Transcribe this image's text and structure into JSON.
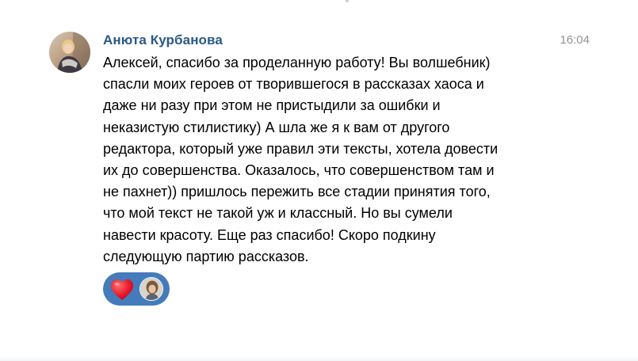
{
  "message": {
    "author": "Анюта Курбанова",
    "time": "16:04",
    "text": "Алексей, спасибо за проделанную работу! Вы волшебник)\nспасли моих героев от творившегося в рассказах хаоса и\nдаже ни разу  при этом не пристыдили за ошибки и\nнеказистую стилистику) А шла же я к вам от другого\nредактора, который уже правил эти тексты, хотела довести\nих до совершенства. Оказалось, что совершенством там и\nне пахнет)) пришлось пережить все стадии принятия того,\nчто мой текст не такой уж и классный. Но вы сумели\nнавести красоту. Еще раз спасибо! Скоро подкину\nследующую партию рассказов.",
    "avatar_icon": "user-avatar",
    "reactions": {
      "emoji_icon": "heart-icon",
      "reactor_icon": "reactor-avatar",
      "accent": "#447bba"
    }
  },
  "colors": {
    "author": "#2a5885",
    "time": "#939393",
    "text": "#000000"
  }
}
